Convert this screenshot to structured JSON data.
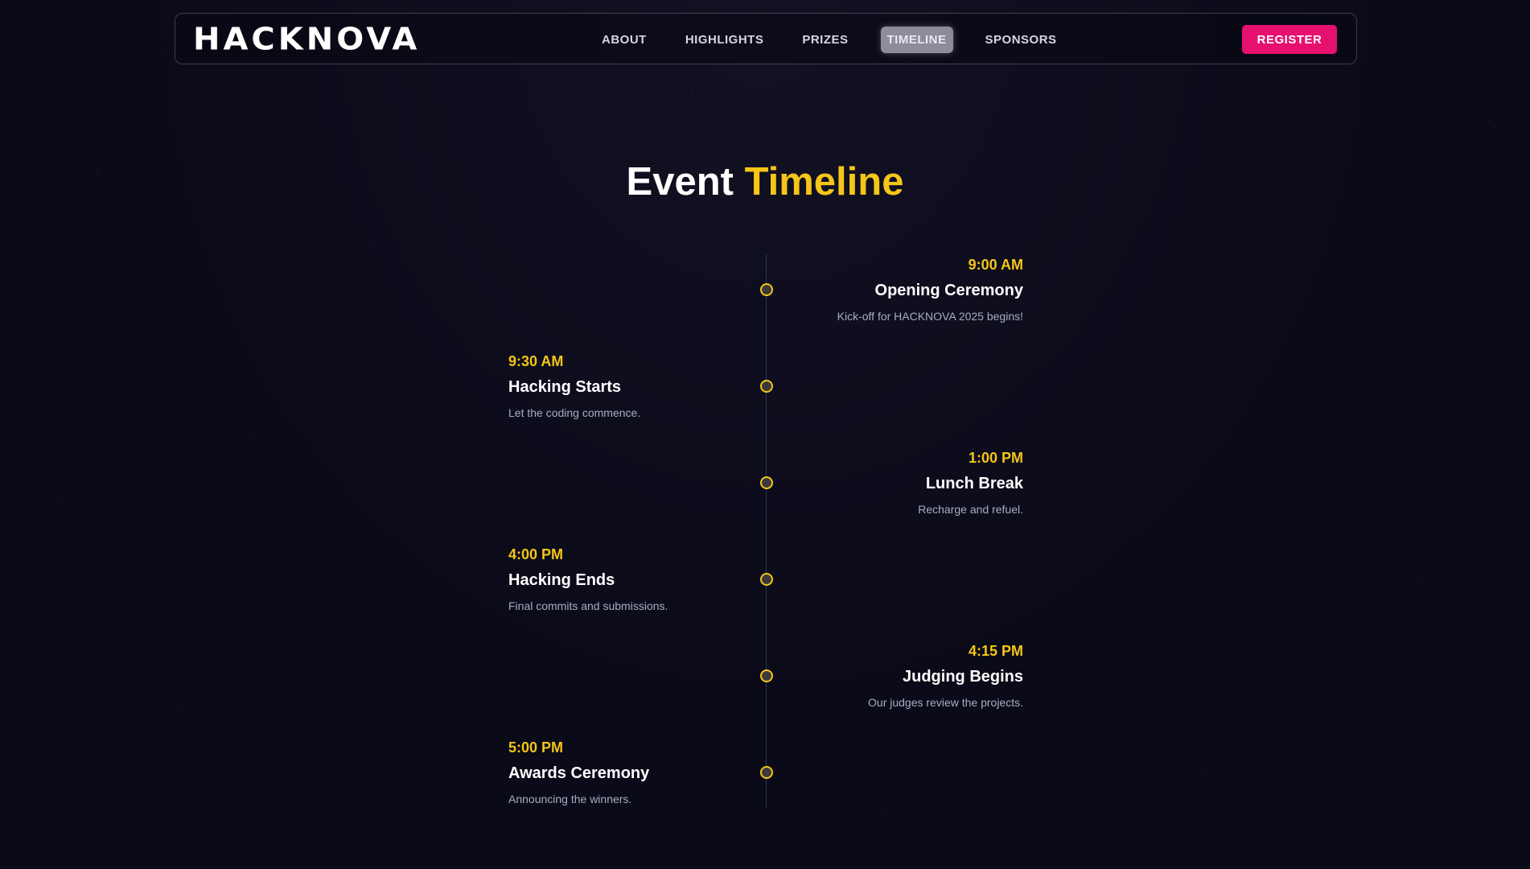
{
  "nav": {
    "logo_text": "HACKNOVA",
    "links": [
      {
        "label": "ABOUT",
        "active": false
      },
      {
        "label": "HIGHLIGHTS",
        "active": false
      },
      {
        "label": "PRIZES",
        "active": false
      },
      {
        "label": "TIMELINE",
        "active": true
      },
      {
        "label": "SPONSORS",
        "active": false
      }
    ],
    "register_label": "REGISTER"
  },
  "section": {
    "title_main": "Event ",
    "title_accent": "Timeline"
  },
  "timeline": [
    {
      "side": "right",
      "time": "9:00 AM",
      "title": "Opening Ceremony",
      "desc": "Kick-off for HACKNOVA 2025 begins!"
    },
    {
      "side": "left",
      "time": "9:30 AM",
      "title": "Hacking Starts",
      "desc": "Let the coding commence."
    },
    {
      "side": "right",
      "time": "1:00 PM",
      "title": "Lunch Break",
      "desc": "Recharge and refuel."
    },
    {
      "side": "left",
      "time": "4:00 PM",
      "title": "Hacking Ends",
      "desc": "Final commits and submissions."
    },
    {
      "side": "right",
      "time": "4:15 PM",
      "title": "Judging Begins",
      "desc": "Our judges review the projects."
    },
    {
      "side": "left",
      "time": "5:00 PM",
      "title": "Awards Ceremony",
      "desc": "Announcing the winners."
    }
  ],
  "colors": {
    "background": "#0a0a18",
    "accent_yellow": "#f5c518",
    "accent_pink": "#e6106f",
    "muted_text": "#a6aec4"
  }
}
